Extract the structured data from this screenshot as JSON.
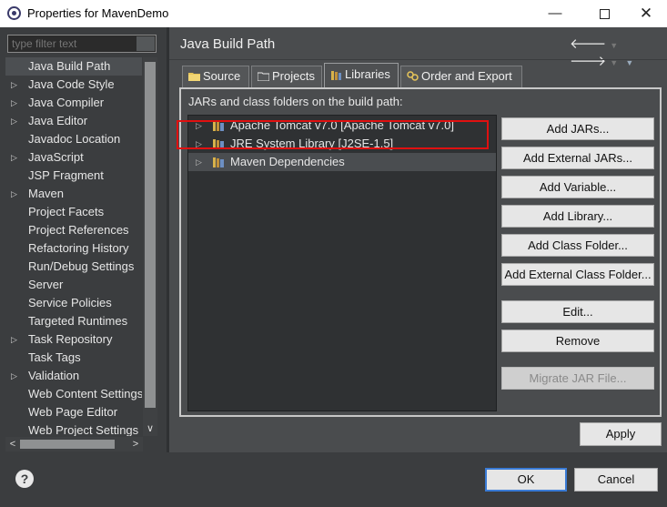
{
  "window": {
    "title": "Properties for MavenDemo",
    "minimize_label": "—",
    "close_label": "✕"
  },
  "sidebar": {
    "filter_placeholder": "type filter text",
    "items": [
      {
        "label": "Java Build Path",
        "expandable": false,
        "selected": true
      },
      {
        "label": "Java Code Style",
        "expandable": true
      },
      {
        "label": "Java Compiler",
        "expandable": true
      },
      {
        "label": "Java Editor",
        "expandable": true
      },
      {
        "label": "Javadoc Location",
        "expandable": false
      },
      {
        "label": "JavaScript",
        "expandable": true
      },
      {
        "label": "JSP Fragment",
        "expandable": false
      },
      {
        "label": "Maven",
        "expandable": true
      },
      {
        "label": "Project Facets",
        "expandable": false
      },
      {
        "label": "Project References",
        "expandable": false
      },
      {
        "label": "Refactoring History",
        "expandable": false
      },
      {
        "label": "Run/Debug Settings",
        "expandable": false
      },
      {
        "label": "Server",
        "expandable": false
      },
      {
        "label": "Service Policies",
        "expandable": false
      },
      {
        "label": "Targeted Runtimes",
        "expandable": false
      },
      {
        "label": "Task Repository",
        "expandable": true
      },
      {
        "label": "Task Tags",
        "expandable": false
      },
      {
        "label": "Validation",
        "expandable": true
      },
      {
        "label": "Web Content Settings",
        "expandable": false
      },
      {
        "label": "Web Page Editor",
        "expandable": false
      },
      {
        "label": "Web Project Settings",
        "expandable": false
      }
    ]
  },
  "page": {
    "title": "Java Build Path",
    "tabs": [
      {
        "label": "Source",
        "icon": "source-folder-icon"
      },
      {
        "label": "Projects",
        "icon": "projects-folder-icon"
      },
      {
        "label": "Libraries",
        "icon": "libraries-icon",
        "active": true
      },
      {
        "label": "Order and Export",
        "icon": "order-export-icon"
      }
    ],
    "caption": "JARs and class folders on the build path:",
    "libraries": [
      {
        "label": "Apache Tomcat v7.0 [Apache Tomcat v7.0]"
      },
      {
        "label": "JRE System Library [J2SE-1.5]"
      },
      {
        "label": "Maven Dependencies",
        "highlighted": true
      }
    ],
    "buttons": [
      {
        "label": "Add JARs...",
        "enabled": true
      },
      {
        "label": "Add External JARs...",
        "enabled": true
      },
      {
        "label": "Add Variable...",
        "enabled": true
      },
      {
        "label": "Add Library...",
        "enabled": true
      },
      {
        "label": "Add Class Folder...",
        "enabled": true
      },
      {
        "label": "Add External Class Folder...",
        "enabled": true
      },
      {
        "label": "Edit...",
        "enabled": true
      },
      {
        "label": "Remove",
        "enabled": true
      },
      {
        "label": "Migrate JAR File...",
        "enabled": false
      }
    ],
    "apply_label": "Apply"
  },
  "footer": {
    "help_label": "?",
    "ok_label": "OK",
    "cancel_label": "Cancel"
  },
  "colors": {
    "highlight_border": "#e01010",
    "default_button_border": "#3a7bd5"
  }
}
